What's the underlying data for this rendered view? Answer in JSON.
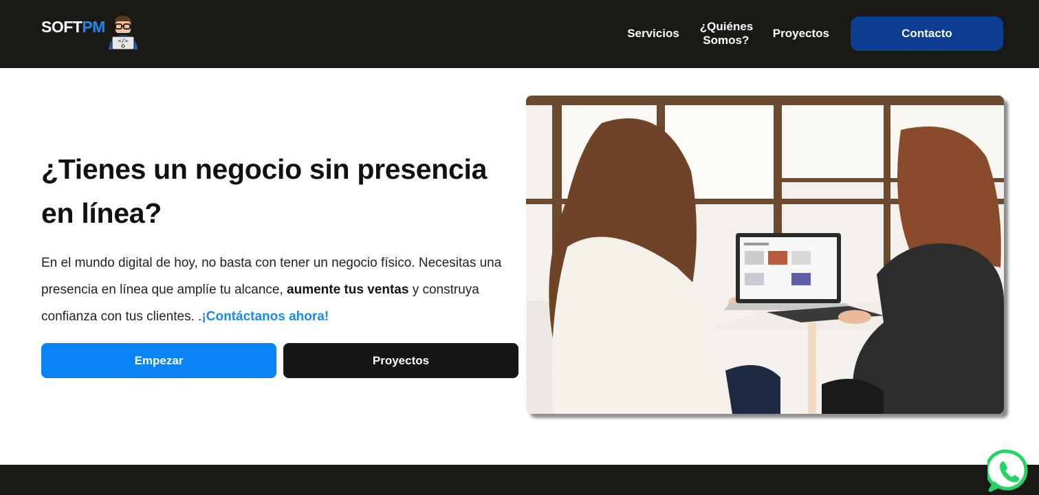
{
  "header": {
    "logo": {
      "soft": "SOFT",
      "pm": "PM"
    },
    "nav": {
      "servicios": "Servicios",
      "quienes_line1": "¿Quiénes",
      "quienes_line2": "Somos?",
      "proyectos": "Proyectos",
      "contacto": "Contacto"
    }
  },
  "hero": {
    "title": "¿Tienes un negocio sin presencia en línea?",
    "text_part1": "En el mundo digital de hoy, no basta con tener un negocio físico. Necesitas una presencia en línea que amplíe tu alcance, ",
    "text_bold": "aumente tus ventas",
    "text_part2": " y construya confianza con tus clientes. .",
    "text_link": "¡Contáctanos ahora!",
    "buttons": {
      "start": "Empezar",
      "projects": "Proyectos"
    }
  },
  "icons": {
    "whatsapp": "whatsapp-icon",
    "logo_mascot": "developer-mascot-icon"
  },
  "colors": {
    "header_bg": "#1a1915",
    "accent_blue": "#1e88f0",
    "contact_btn": "#0b3d91",
    "whatsapp_green": "#25d366"
  }
}
